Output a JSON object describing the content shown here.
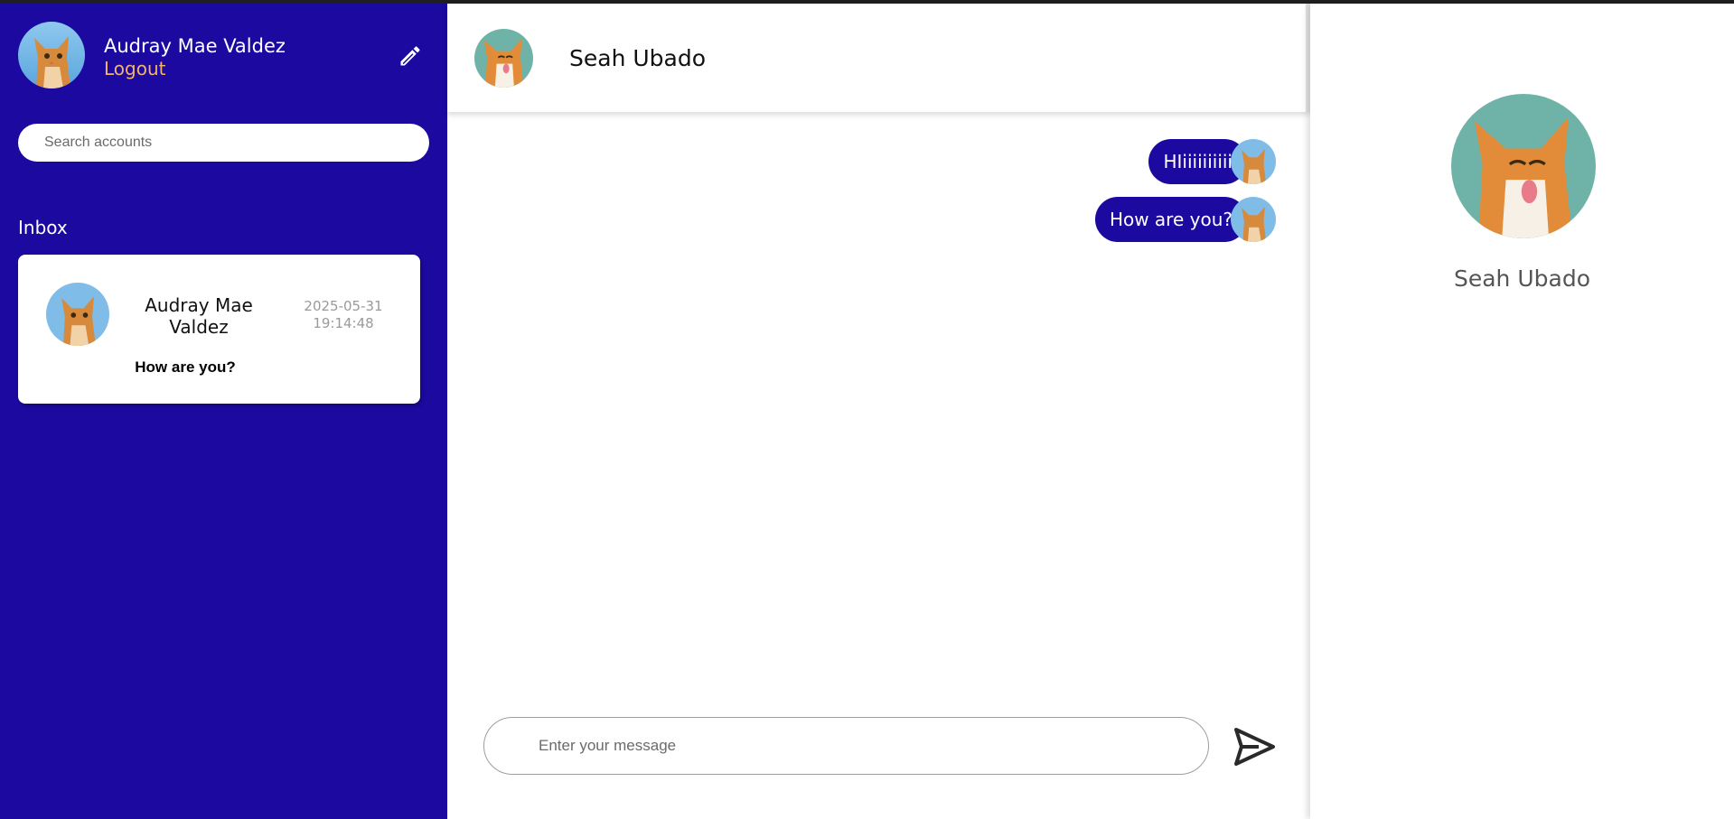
{
  "current_user": {
    "name": "Audray Mae Valdez",
    "logout_label": "Logout"
  },
  "sidebar": {
    "search_placeholder": "Search accounts",
    "inbox_label": "Inbox",
    "conversations": [
      {
        "name": "Audray Mae Valdez",
        "timestamp": "2025-05-31 19:14:48",
        "last_message": "How are you?"
      }
    ]
  },
  "chat": {
    "contact_name": "Seah Ubado",
    "messages": [
      {
        "text": "HIiiiiiiiiii"
      },
      {
        "text": "How are you?"
      }
    ],
    "input_placeholder": "Enter your message"
  },
  "profile": {
    "name": "Seah Ubado"
  },
  "colors": {
    "sidebar_bg": "#1c09a0",
    "bubble_bg": "#1c09a0",
    "logout": "#f2b56b"
  },
  "icons": {
    "edit": "pencil-icon",
    "send": "send-icon"
  }
}
